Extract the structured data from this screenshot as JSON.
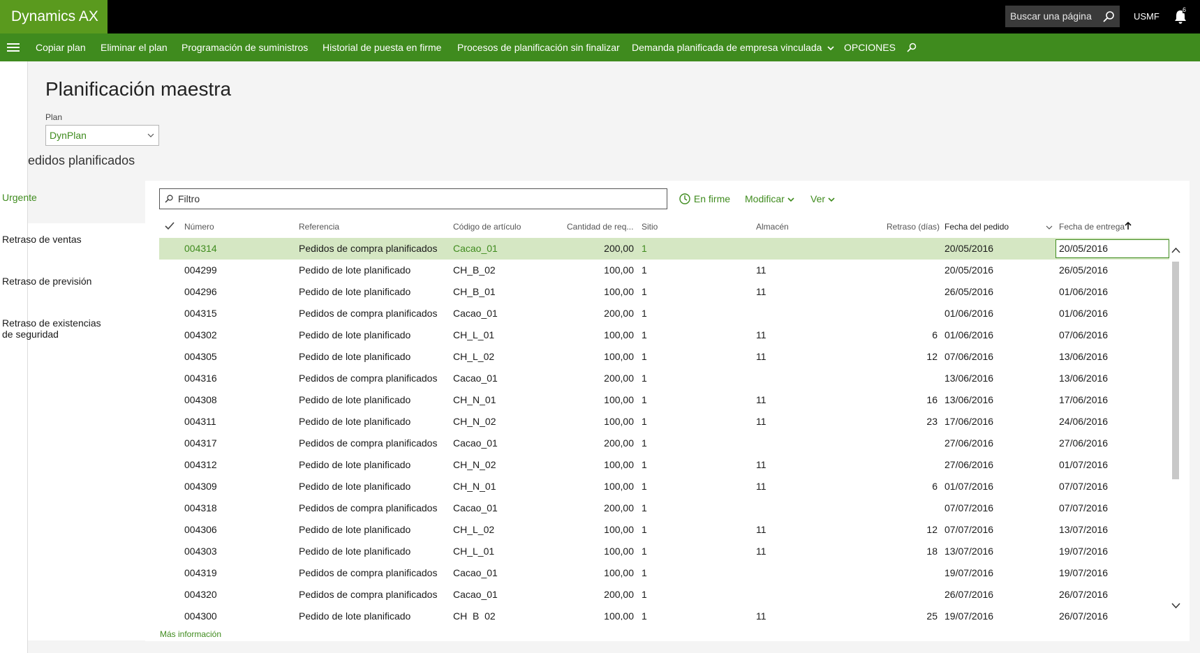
{
  "app": {
    "title": "Dynamics AX",
    "company": "USMF",
    "notifications": "6"
  },
  "search": {
    "placeholder": "Buscar una página"
  },
  "actions": {
    "copy_plan": "Copiar plan",
    "delete_plan": "Eliminar el plan",
    "supply_schedule": "Programación de suministros",
    "firming_history": "Historial de puesta en firme",
    "unfinished_processes": "Procesos de planificación sin finalizar",
    "intercompany_demand": "Demanda planificada de empresa vinculada",
    "options": "OPCIONES"
  },
  "page": {
    "title": "Planificación maestra",
    "plan_label": "Plan",
    "plan_value": "DynPlan",
    "section_title": "edidos planificados"
  },
  "sidenav": {
    "items": [
      "Urgente",
      "Retraso de ventas",
      "Retraso de previsión",
      "Retraso de existencias",
      "de seguridad"
    ]
  },
  "toolbar": {
    "filter_placeholder": "Filtro",
    "firm": "En firme",
    "modify": "Modificar",
    "view": "Ver"
  },
  "grid": {
    "columns": {
      "number": "Número",
      "reference": "Referencia",
      "item": "Código de artículo",
      "qty": "Cantidad de req...",
      "site": "Sitio",
      "warehouse": "Almacén",
      "delay": "Retraso (días)",
      "order_date": "Fecha del pedido",
      "delivery_date": "Fecha de entrega"
    },
    "rows": [
      [
        "004314",
        "Pedidos de compra planificados",
        "Cacao_01",
        "200,00",
        "1",
        "",
        "",
        "20/05/2016",
        "20/05/2016"
      ],
      [
        "004299",
        "Pedido de lote planificado",
        "CH_B_02",
        "100,00",
        "1",
        "11",
        "",
        "20/05/2016",
        "26/05/2016"
      ],
      [
        "004296",
        "Pedido de lote planificado",
        "CH_B_01",
        "100,00",
        "1",
        "11",
        "",
        "26/05/2016",
        "01/06/2016"
      ],
      [
        "004315",
        "Pedidos de compra planificados",
        "Cacao_01",
        "200,00",
        "1",
        "",
        "",
        "01/06/2016",
        "01/06/2016"
      ],
      [
        "004302",
        "Pedido de lote planificado",
        "CH_L_01",
        "100,00",
        "1",
        "11",
        "6",
        "01/06/2016",
        "07/06/2016"
      ],
      [
        "004305",
        "Pedido de lote planificado",
        "CH_L_02",
        "100,00",
        "1",
        "11",
        "12",
        "07/06/2016",
        "13/06/2016"
      ],
      [
        "004316",
        "Pedidos de compra planificados",
        "Cacao_01",
        "200,00",
        "1",
        "",
        "",
        "13/06/2016",
        "13/06/2016"
      ],
      [
        "004308",
        "Pedido de lote planificado",
        "CH_N_01",
        "100,00",
        "1",
        "11",
        "16",
        "13/06/2016",
        "17/06/2016"
      ],
      [
        "004311",
        "Pedido de lote planificado",
        "CH_N_02",
        "100,00",
        "1",
        "11",
        "23",
        "17/06/2016",
        "24/06/2016"
      ],
      [
        "004317",
        "Pedidos de compra planificados",
        "Cacao_01",
        "200,00",
        "1",
        "",
        "",
        "27/06/2016",
        "27/06/2016"
      ],
      [
        "004312",
        "Pedido de lote planificado",
        "CH_N_02",
        "100,00",
        "1",
        "11",
        "",
        "27/06/2016",
        "01/07/2016"
      ],
      [
        "004309",
        "Pedido de lote planificado",
        "CH_N_01",
        "100,00",
        "1",
        "11",
        "6",
        "01/07/2016",
        "07/07/2016"
      ],
      [
        "004318",
        "Pedidos de compra planificados",
        "Cacao_01",
        "200,00",
        "1",
        "",
        "",
        "07/07/2016",
        "07/07/2016"
      ],
      [
        "004306",
        "Pedido de lote planificado",
        "CH_L_02",
        "100,00",
        "1",
        "11",
        "12",
        "07/07/2016",
        "13/07/2016"
      ],
      [
        "004303",
        "Pedido de lote planificado",
        "CH_L_01",
        "100,00",
        "1",
        "11",
        "18",
        "13/07/2016",
        "19/07/2016"
      ],
      [
        "004319",
        "Pedidos de compra planificados",
        "Cacao_01",
        "100,00",
        "1",
        "",
        "",
        "19/07/2016",
        "19/07/2016"
      ],
      [
        "004320",
        "Pedidos de compra planificados",
        "Cacao_01",
        "200,00",
        "1",
        "",
        "",
        "26/07/2016",
        "26/07/2016"
      ],
      [
        "004300",
        "Pedido de lote planificado",
        "CH_B_02",
        "100,00",
        "1",
        "11",
        "25",
        "19/07/2016",
        "26/07/2016"
      ]
    ],
    "selected_row": 0
  },
  "footer": {
    "more_info": "Más información"
  },
  "colors": {
    "brand": "#5a9a1e",
    "actionbar": "#3f8b1e",
    "selected_row": "#d5e7c3"
  }
}
